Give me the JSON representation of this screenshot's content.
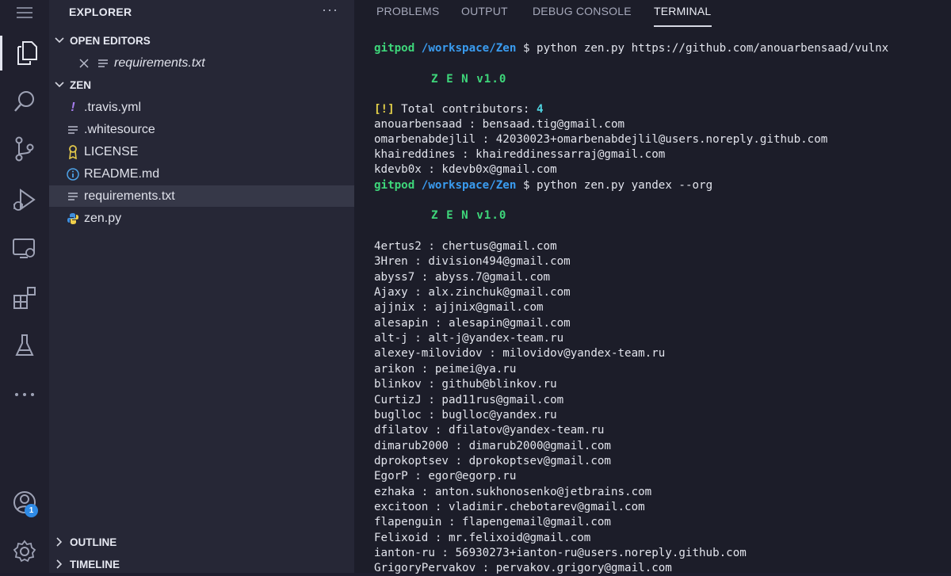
{
  "sidebar": {
    "title": "EXPLORER",
    "more": "···",
    "open_editors_label": "OPEN EDITORS",
    "open_editor_file": "requirements.txt",
    "folder_label": "ZEN",
    "files": [
      ".travis.yml",
      ".whitesource",
      "LICENSE",
      "README.md",
      "requirements.txt",
      "zen.py"
    ],
    "outline_label": "OUTLINE",
    "timeline_label": "TIMELINE"
  },
  "activity": {
    "badge_count": "1"
  },
  "panel": {
    "tabs": [
      "PROBLEMS",
      "OUTPUT",
      "DEBUG CONSOLE",
      "TERMINAL"
    ]
  },
  "terminal": {
    "user": "gitpod",
    "path": "/workspace/Zen",
    "prompt_symbol": "$",
    "cmd1": "python zen.py https://github.com/anouarbensaad/vulnx",
    "banner": "Z E N v1.0",
    "contrib_mark": "[!]",
    "contrib_text": "Total contributors:",
    "contrib_count": "4",
    "result1": [
      "anouarbensaad : bensaad.tig@gmail.com",
      "omarbenabdejlil : 42030023+omarbenabdejlil@users.noreply.github.com",
      "khaireddines : khaireddinessarraj@gmail.com",
      "kdevb0x : kdevb0x@gmail.com"
    ],
    "cmd2": "python zen.py yandex --org",
    "result2": [
      "4ertus2 : chertus@gmail.com",
      "3Hren : division494@gmail.com",
      "abyss7 : abyss.7@gmail.com",
      "Ajaxy : alx.zinchuk@gmail.com",
      "ajjnix : ajjnix@gmail.com",
      "alesapin : alesapin@gmail.com",
      "alt-j : alt-j@yandex-team.ru",
      "alexey-milovidov : milovidov@yandex-team.ru",
      "arikon : peimei@ya.ru",
      "blinkov : github@blinkov.ru",
      "CurtizJ : pad11rus@gmail.com",
      "buglloc : buglloc@yandex.ru",
      "dfilatov : dfilatov@yandex-team.ru",
      "dimarub2000 : dimarub2000@gmail.com",
      "dprokoptsev : dprokoptsev@gmail.com",
      "EgorP : egor@egorp.ru",
      "ezhaka : anton.sukhonosenko@jetbrains.com",
      "excitoon : vladimir.chebotarev@gmail.com",
      "flapenguin : flapengemail@gmail.com",
      "Felixoid : mr.felixoid@gmail.com",
      "ianton-ru : 56930273+ianton-ru@users.noreply.github.com",
      "GrigoryPervakov : pervakov.grigory@gmail.com"
    ]
  }
}
